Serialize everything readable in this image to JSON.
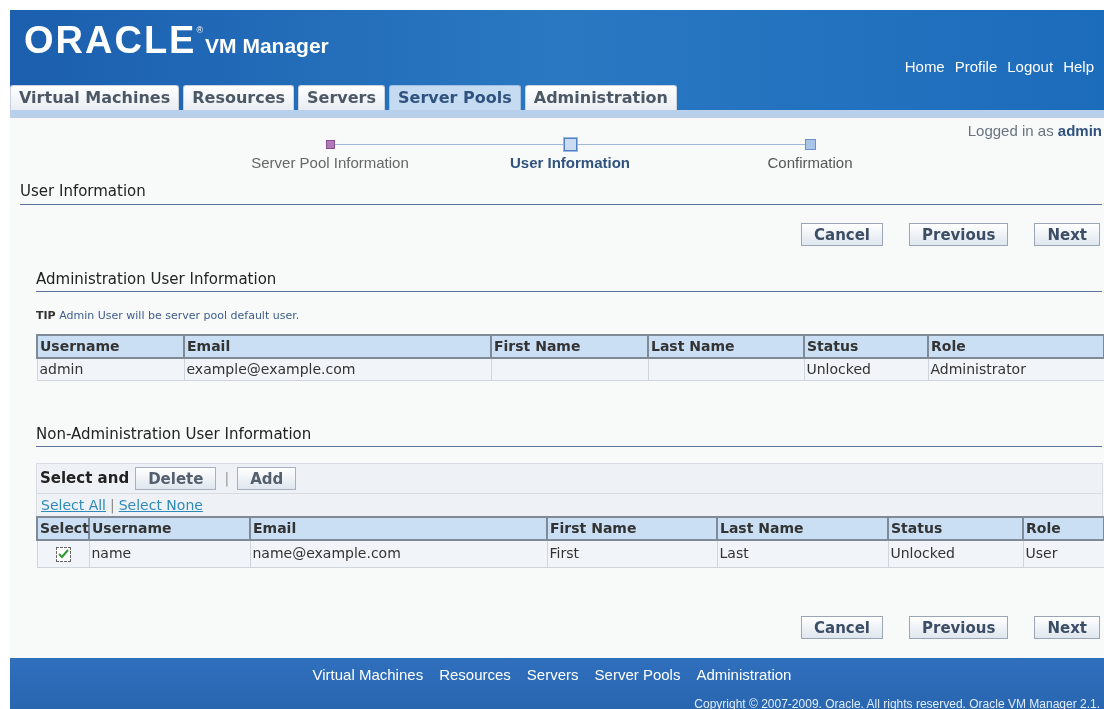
{
  "header": {
    "logo": "ORACLE",
    "logo_mark": "®",
    "product": "VM Manager",
    "global_links": [
      "Home",
      "Profile",
      "Logout",
      "Help"
    ]
  },
  "tabs": [
    {
      "label": "Virtual Machines",
      "selected": false
    },
    {
      "label": "Resources",
      "selected": false
    },
    {
      "label": "Servers",
      "selected": false
    },
    {
      "label": "Server Pools",
      "selected": true
    },
    {
      "label": "Administration",
      "selected": false
    }
  ],
  "login": {
    "text": "Logged in as",
    "user": "admin"
  },
  "train": [
    {
      "label": "Server Pool Information",
      "visited": true,
      "selected": false
    },
    {
      "label": "User Information",
      "selected": true
    },
    {
      "label": "Confirmation",
      "visited": false,
      "selected": false
    }
  ],
  "page_title": "User Information",
  "top_buttons": [
    "Cancel",
    "Previous",
    "Next"
  ],
  "admin_section": {
    "title": "Administration User Information",
    "tip_label": "TIP",
    "tip": "Admin User will be server pool default user.",
    "columns": [
      "Username",
      "Email",
      "First Name",
      "Last Name",
      "Status",
      "Role"
    ],
    "rows": [
      [
        "admin",
        "example@example.com",
        "",
        "",
        "Unlocked",
        "Administrator"
      ]
    ]
  },
  "user_section": {
    "title": "Non-Administration User Information",
    "toolbar_label": "Select and",
    "actions": [
      "Delete",
      "Add"
    ],
    "separator": "|",
    "select_links": [
      "Select All",
      "Select None"
    ],
    "link_separator": "|",
    "columns": [
      "Select",
      "Username",
      "Email",
      "First Name",
      "Last Name",
      "Status",
      "Role"
    ],
    "rows": [
      {
        "checked": true,
        "cells": [
          "",
          "name",
          "name@example.com",
          "First",
          "Last",
          "Unlocked",
          "User"
        ]
      }
    ]
  },
  "bottom_buttons": [
    "Cancel",
    "Previous",
    "Next"
  ],
  "footer": {
    "links": [
      "Virtual Machines",
      "Resources",
      "Servers",
      "Server Pools",
      "Administration"
    ],
    "copyright": "Copyright © 2007-2009. Oracle. All rights reserved. Oracle VM Manager 2.1."
  }
}
